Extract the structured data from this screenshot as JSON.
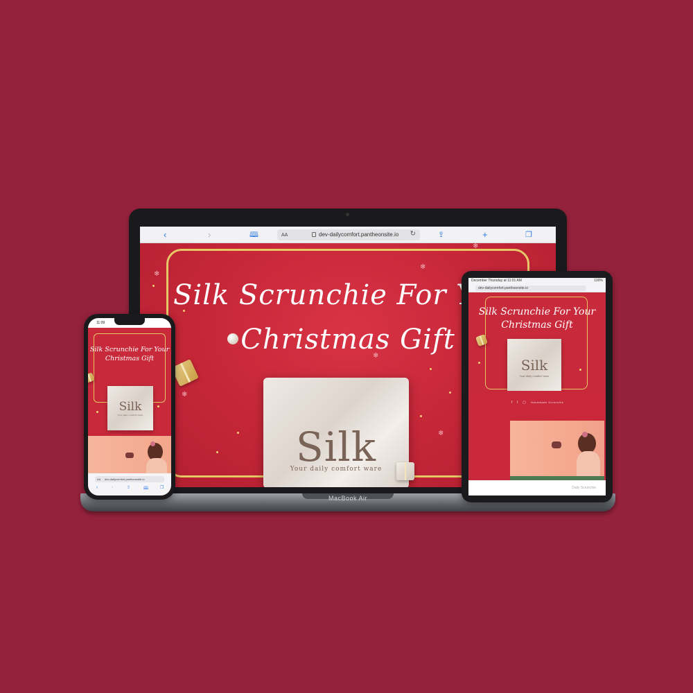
{
  "laptop": {
    "model_label": "MacBook Air",
    "browser": {
      "back_icon": "chevron-left-icon",
      "forward_icon": "chevron-right-icon",
      "reader_icon": "book-icon",
      "text_size_label": "AA",
      "url": "dev-dailycomfort.pantheonsite.io",
      "reload_icon": "reload-icon",
      "share_icon": "share-icon",
      "new_tab_icon": "plus-icon",
      "tabs_icon": "tabs-icon"
    },
    "hero": {
      "title_line1": "Silk Scrunchie For Your",
      "title_line2": "Christmas Gift"
    },
    "product_card": {
      "brand": "Silk",
      "tagline": "Your daily comfort ware"
    }
  },
  "tablet": {
    "status_left": "December Thursday at 11:01 AM",
    "status_right": "100%",
    "url": "dev-dailycomfort.pantheonsite.io",
    "hero": {
      "title_line1": "Silk Scrunchie For Your",
      "title_line2": "Christmas Gift"
    },
    "product_card": {
      "brand": "Silk",
      "tagline": "Your daily comfort ware"
    },
    "social_icons": [
      "facebook-icon",
      "twitter-icon",
      "instagram-icon"
    ],
    "section_label": "Handmade Scrunchie",
    "footer_text": "Daily Scrunchie"
  },
  "phone": {
    "time": "11:09",
    "hero": {
      "title_line1": "Silk Scrunchie For Your",
      "title_line2": "Christmas Gift"
    },
    "product_card": {
      "brand": "Silk",
      "tagline": "Your daily comfort ware"
    },
    "browser": {
      "text_size_label": "AA",
      "url": "dev-dailycomfort.pantheonsite.io"
    }
  },
  "colors": {
    "background": "#95223c",
    "hero_red": "#c8283a",
    "gold_frame": "#e8c766",
    "silk_brown": "#7a6457",
    "ios_blue": "#2f7ae5"
  }
}
